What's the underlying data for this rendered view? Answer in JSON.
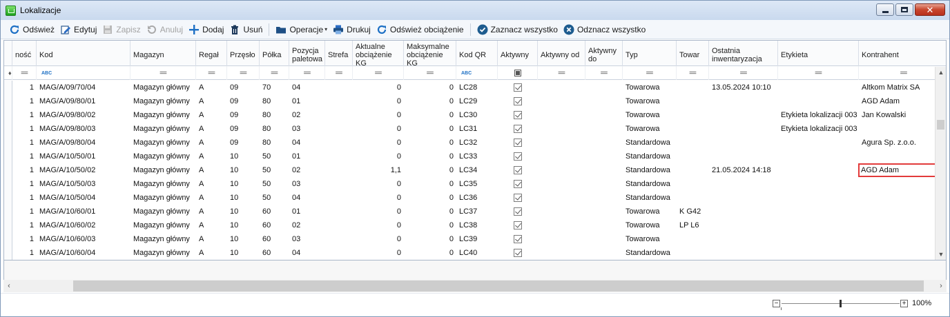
{
  "window": {
    "title": "Lokalizacje",
    "controls": [
      "minimize",
      "maximize",
      "close"
    ]
  },
  "toolbar": [
    {
      "name": "refresh-button",
      "icon": "refresh-icon",
      "label": "Odśwież",
      "enabled": true
    },
    {
      "name": "edit-button",
      "icon": "edit-icon",
      "label": "Edytuj",
      "enabled": true
    },
    {
      "name": "save-button",
      "icon": "save-icon",
      "label": "Zapisz",
      "enabled": false
    },
    {
      "name": "cancel-button",
      "icon": "undo-icon",
      "label": "Anuluj",
      "enabled": false
    },
    {
      "name": "add-button",
      "icon": "plus-icon",
      "label": "Dodaj",
      "enabled": true
    },
    {
      "name": "delete-button",
      "icon": "trash-icon",
      "label": "Usuń",
      "enabled": true
    },
    {
      "name": "operations-button",
      "icon": "folder-icon",
      "label": "Operacje",
      "enabled": true,
      "dropdown": true
    },
    {
      "name": "print-button",
      "icon": "printer-icon",
      "label": "Drukuj",
      "enabled": true
    },
    {
      "name": "refresh-load-button",
      "icon": "refresh-icon",
      "label": "Odśwież obciążenie",
      "enabled": true
    },
    {
      "name": "select-all-button",
      "icon": "check-circle-icon",
      "label": "Zaznacz wszystko",
      "enabled": true
    },
    {
      "name": "deselect-all-button",
      "icon": "x-circle-icon",
      "label": "Odznacz wszystko",
      "enabled": true
    }
  ],
  "columns": [
    {
      "key": "ilosc",
      "label": "ność"
    },
    {
      "key": "kod",
      "label": "Kod"
    },
    {
      "key": "magazyn",
      "label": "Magazyn"
    },
    {
      "key": "regal",
      "label": "Regał"
    },
    {
      "key": "przeslo",
      "label": "Przęsło"
    },
    {
      "key": "polka",
      "label": "Półka"
    },
    {
      "key": "pozycja",
      "label": "Pozycja\npaletowa"
    },
    {
      "key": "strefa",
      "label": "Strefa"
    },
    {
      "key": "akt",
      "label": "Aktualne\nobciążenie KG"
    },
    {
      "key": "maks",
      "label": "Maksymalne\nobciążenie KG"
    },
    {
      "key": "qr",
      "label": "Kod QR"
    },
    {
      "key": "aktywny",
      "label": "Aktywny"
    },
    {
      "key": "aktywny_od",
      "label": "Aktywny od"
    },
    {
      "key": "aktywny_do",
      "label": "Aktywny\ndo"
    },
    {
      "key": "typ",
      "label": "Typ"
    },
    {
      "key": "towar",
      "label": "Towar"
    },
    {
      "key": "ostatnia",
      "label": "Ostatnia\ninwentaryzacja"
    },
    {
      "key": "etykieta",
      "label": "Etykieta"
    },
    {
      "key": "kontrahent",
      "label": "Kontrahent"
    }
  ],
  "rows": [
    {
      "ilosc": "1",
      "kod": "MAG/A/09/70/04",
      "magazyn": "Magazyn główny",
      "regal": "A",
      "przeslo": "09",
      "polka": "70",
      "pozycja": "04",
      "strefa": "",
      "akt": "0",
      "maks": "0",
      "qr": "LC28",
      "aktywny": true,
      "aktywny_od": "",
      "aktywny_do": "",
      "typ": "Towarowa",
      "towar": "",
      "ostatnia": "13.05.2024 10:10",
      "etykieta": "",
      "kontrahent": "Altkom Matrix SA"
    },
    {
      "ilosc": "1",
      "kod": "MAG/A/09/80/01",
      "magazyn": "Magazyn główny",
      "regal": "A",
      "przeslo": "09",
      "polka": "80",
      "pozycja": "01",
      "strefa": "",
      "akt": "0",
      "maks": "0",
      "qr": "LC29",
      "aktywny": true,
      "aktywny_od": "",
      "aktywny_do": "",
      "typ": "Towarowa",
      "towar": "",
      "ostatnia": "",
      "etykieta": "",
      "kontrahent": "AGD Adam"
    },
    {
      "ilosc": "1",
      "kod": "MAG/A/09/80/02",
      "magazyn": "Magazyn główny",
      "regal": "A",
      "przeslo": "09",
      "polka": "80",
      "pozycja": "02",
      "strefa": "",
      "akt": "0",
      "maks": "0",
      "qr": "LC30",
      "aktywny": true,
      "aktywny_od": "",
      "aktywny_do": "",
      "typ": "Towarowa",
      "towar": "",
      "ostatnia": "",
      "etykieta": "Etykieta lokalizacji 003",
      "kontrahent": "Jan Kowalski"
    },
    {
      "ilosc": "1",
      "kod": "MAG/A/09/80/03",
      "magazyn": "Magazyn główny",
      "regal": "A",
      "przeslo": "09",
      "polka": "80",
      "pozycja": "03",
      "strefa": "",
      "akt": "0",
      "maks": "0",
      "qr": "LC31",
      "aktywny": true,
      "aktywny_od": "",
      "aktywny_do": "",
      "typ": "Towarowa",
      "towar": "",
      "ostatnia": "",
      "etykieta": "Etykieta lokalizacji 003",
      "kontrahent": ""
    },
    {
      "ilosc": "1",
      "kod": "MAG/A/09/80/04",
      "magazyn": "Magazyn główny",
      "regal": "A",
      "przeslo": "09",
      "polka": "80",
      "pozycja": "04",
      "strefa": "",
      "akt": "0",
      "maks": "0",
      "qr": "LC32",
      "aktywny": true,
      "aktywny_od": "",
      "aktywny_do": "",
      "typ": "Standardowa",
      "towar": "",
      "ostatnia": "",
      "etykieta": "",
      "kontrahent": "Agura Sp. z.o.o."
    },
    {
      "ilosc": "1",
      "kod": "MAG/A/10/50/01",
      "magazyn": "Magazyn główny",
      "regal": "A",
      "przeslo": "10",
      "polka": "50",
      "pozycja": "01",
      "strefa": "",
      "akt": "0",
      "maks": "0",
      "qr": "LC33",
      "aktywny": true,
      "aktywny_od": "",
      "aktywny_do": "",
      "typ": "Standardowa",
      "towar": "",
      "ostatnia": "",
      "etykieta": "",
      "kontrahent": ""
    },
    {
      "ilosc": "1",
      "kod": "MAG/A/10/50/02",
      "magazyn": "Magazyn główny",
      "regal": "A",
      "przeslo": "10",
      "polka": "50",
      "pozycja": "02",
      "strefa": "",
      "akt": "1,1",
      "maks": "0",
      "qr": "LC34",
      "aktywny": true,
      "aktywny_od": "",
      "aktywny_do": "",
      "typ": "Standardowa",
      "towar": "",
      "ostatnia": "21.05.2024 14:18",
      "etykieta": "",
      "kontrahent": "AGD Adam",
      "highlight": true
    },
    {
      "ilosc": "1",
      "kod": "MAG/A/10/50/03",
      "magazyn": "Magazyn główny",
      "regal": "A",
      "przeslo": "10",
      "polka": "50",
      "pozycja": "03",
      "strefa": "",
      "akt": "0",
      "maks": "0",
      "qr": "LC35",
      "aktywny": true,
      "aktywny_od": "",
      "aktywny_do": "",
      "typ": "Standardowa",
      "towar": "",
      "ostatnia": "",
      "etykieta": "",
      "kontrahent": ""
    },
    {
      "ilosc": "1",
      "kod": "MAG/A/10/50/04",
      "magazyn": "Magazyn główny",
      "regal": "A",
      "przeslo": "10",
      "polka": "50",
      "pozycja": "04",
      "strefa": "",
      "akt": "0",
      "maks": "0",
      "qr": "LC36",
      "aktywny": true,
      "aktywny_od": "",
      "aktywny_do": "",
      "typ": "Standardowa",
      "towar": "",
      "ostatnia": "",
      "etykieta": "",
      "kontrahent": ""
    },
    {
      "ilosc": "1",
      "kod": "MAG/A/10/60/01",
      "magazyn": "Magazyn główny",
      "regal": "A",
      "przeslo": "10",
      "polka": "60",
      "pozycja": "01",
      "strefa": "",
      "akt": "0",
      "maks": "0",
      "qr": "LC37",
      "aktywny": true,
      "aktywny_od": "",
      "aktywny_do": "",
      "typ": "Towarowa",
      "towar": "K G42",
      "ostatnia": "",
      "etykieta": "",
      "kontrahent": ""
    },
    {
      "ilosc": "1",
      "kod": "MAG/A/10/60/02",
      "magazyn": "Magazyn główny",
      "regal": "A",
      "przeslo": "10",
      "polka": "60",
      "pozycja": "02",
      "strefa": "",
      "akt": "0",
      "maks": "0",
      "qr": "LC38",
      "aktywny": true,
      "aktywny_od": "",
      "aktywny_do": "",
      "typ": "Towarowa",
      "towar": "LP L6",
      "ostatnia": "",
      "etykieta": "",
      "kontrahent": ""
    },
    {
      "ilosc": "1",
      "kod": "MAG/A/10/60/03",
      "magazyn": "Magazyn główny",
      "regal": "A",
      "przeslo": "10",
      "polka": "60",
      "pozycja": "03",
      "strefa": "",
      "akt": "0",
      "maks": "0",
      "qr": "LC39",
      "aktywny": true,
      "aktywny_od": "",
      "aktywny_do": "",
      "typ": "Towarowa",
      "towar": "",
      "ostatnia": "",
      "etykieta": "",
      "kontrahent": ""
    },
    {
      "ilosc": "1",
      "kod": "MAG/A/10/60/04",
      "magazyn": "Magazyn główny",
      "regal": "A",
      "przeslo": "10",
      "polka": "60",
      "pozycja": "04",
      "strefa": "",
      "akt": "0",
      "maks": "0",
      "qr": "LC40",
      "aktywny": true,
      "aktywny_od": "",
      "aktywny_do": "",
      "typ": "Standardowa",
      "towar": "",
      "ostatnia": "",
      "etykieta": "",
      "kontrahent": ""
    }
  ],
  "zoom": {
    "label": "100%",
    "minus": "−",
    "plus": "+"
  },
  "colors": {
    "accent": "#1c6fc4",
    "highlight_border": "#e23a3a",
    "close_button": "#c8462e"
  }
}
